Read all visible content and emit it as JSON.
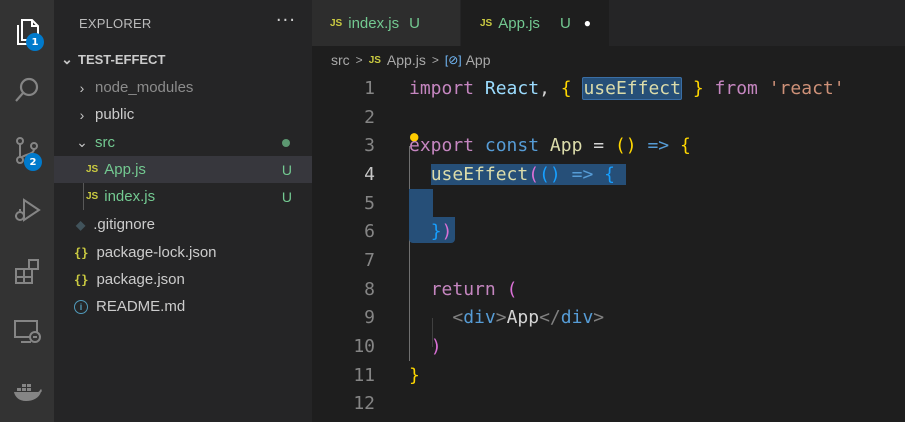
{
  "activity_bar": {
    "explorer_badge": "1",
    "source_control_badge": "2"
  },
  "explorer": {
    "title": "EXPLORER",
    "more": "···",
    "project": "TEST-EFFECT",
    "items": [
      {
        "label": "node_modules",
        "kind": "folder"
      },
      {
        "label": "public",
        "kind": "folder"
      },
      {
        "label": "src",
        "kind": "folder-open"
      },
      {
        "label": "App.js",
        "status": "U"
      },
      {
        "label": "index.js",
        "status": "U"
      },
      {
        "label": ".gitignore"
      },
      {
        "label": "package-lock.json"
      },
      {
        "label": "package.json"
      },
      {
        "label": "README.md"
      }
    ],
    "js_icon": "JS",
    "json_icon": "{}",
    "info_icon": "i"
  },
  "tabs": [
    {
      "label": "index.js",
      "status": "U"
    },
    {
      "label": "App.js",
      "status": "U",
      "modified_dot": "●"
    }
  ],
  "breadcrumb": {
    "parts": [
      "src",
      "App.js",
      "App"
    ]
  },
  "editor": {
    "line_numbers": [
      "1",
      "2",
      "3",
      "4",
      "5",
      "6",
      "7",
      "8",
      "9",
      "10",
      "11",
      "12"
    ],
    "current_line": "4"
  }
}
